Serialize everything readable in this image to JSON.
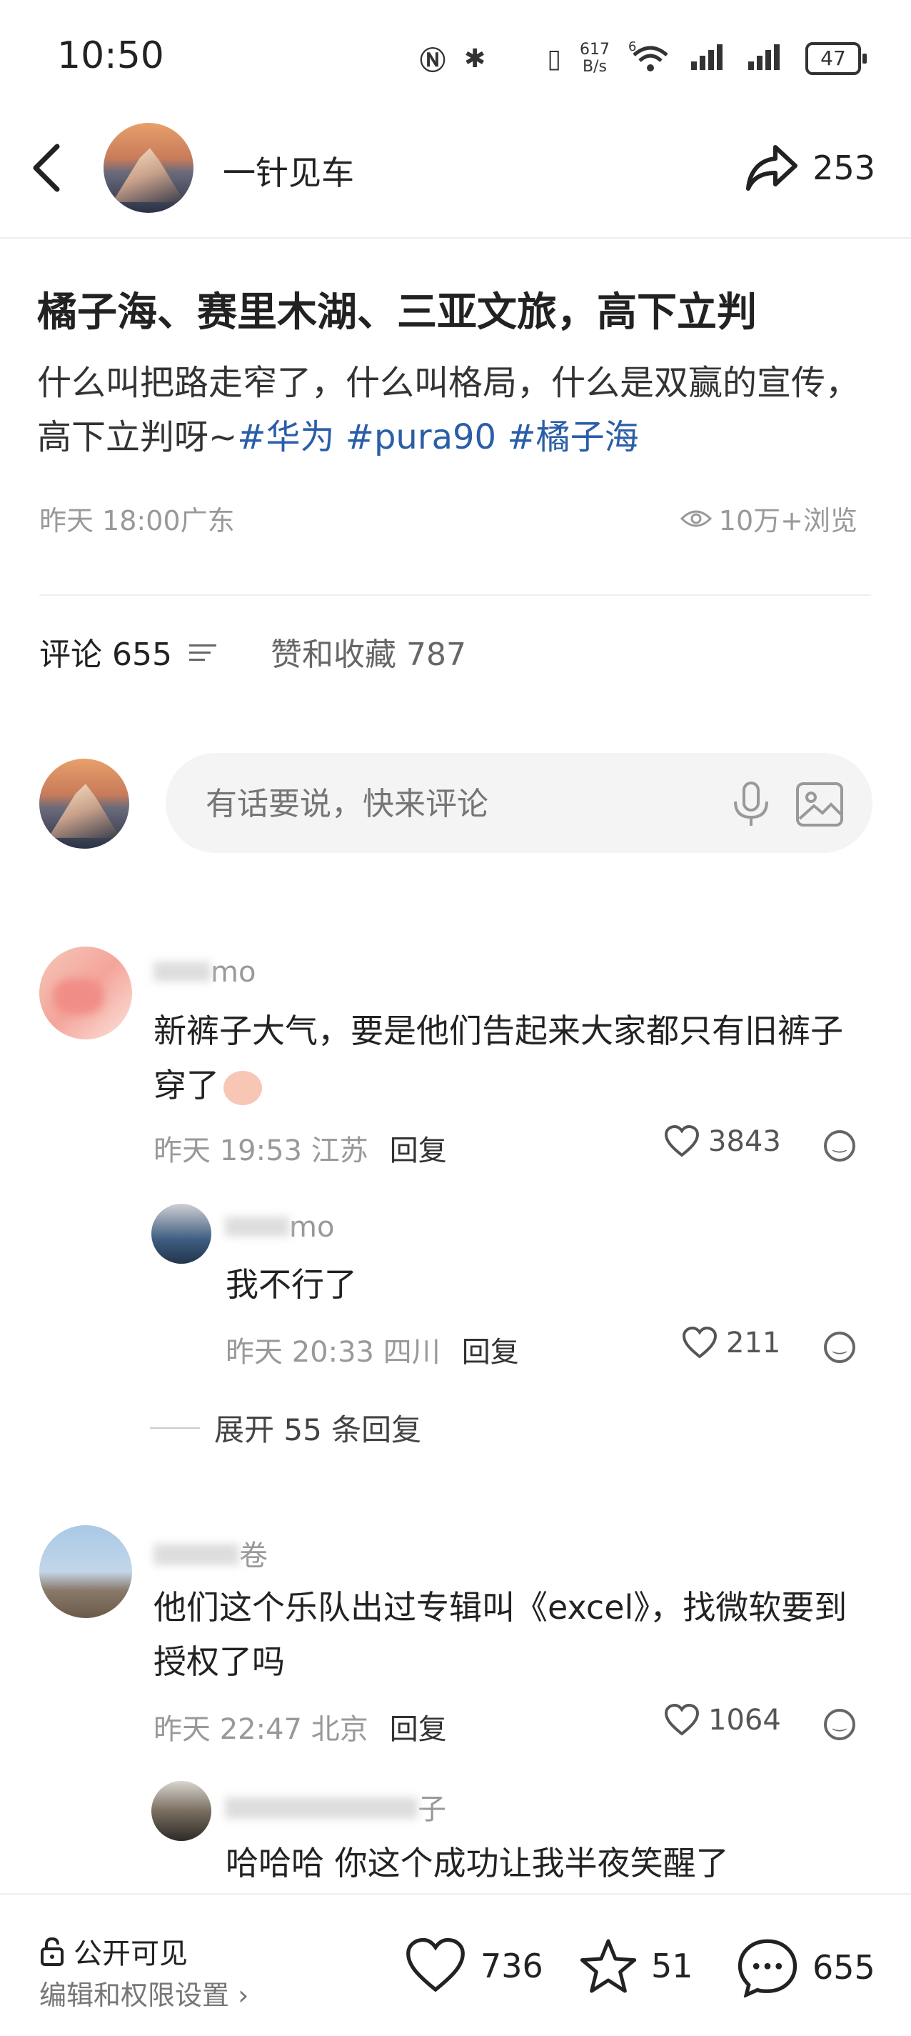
{
  "status": {
    "time": "10:50",
    "net_speed_top": "617",
    "net_speed_bottom": "B/s",
    "battery": "47",
    "signal_label": "6"
  },
  "header": {
    "author": "一针见车",
    "share_count": "253"
  },
  "post": {
    "title": "橘子海、赛里木湖、三亚文旅，高下立判",
    "body_text": "什么叫把路走窄了，什么叫格局，什么是双赢的宣传，高下立判呀~",
    "tags": [
      "#华为",
      "#pura90",
      "#橘子海"
    ],
    "date": "昨天 18:00",
    "location": "广东",
    "views": "10万+浏览"
  },
  "tabs": {
    "comments_label": "评论 655",
    "likes_label": "赞和收藏 787"
  },
  "comment_input": {
    "placeholder": "有话要说，快来评论"
  },
  "comments": [
    {
      "name": "mo",
      "text": "新裤子大气，要是他们告起来大家都只有旧裤子穿了",
      "time": "昨天 19:53 江苏",
      "reply": "回复",
      "likes": "3843"
    },
    {
      "name": "mo",
      "text": "我不行了",
      "time": "昨天 20:33 四川",
      "reply": "回复",
      "likes": "211"
    },
    {
      "name": "卷",
      "text": "他们这个乐队出过专辑叫《excel》，找微软要到授权了吗",
      "time": "昨天 22:47 北京",
      "reply": "回复",
      "likes": "1064"
    },
    {
      "name": "子",
      "text": "哈哈哈 你这个成功让我半夜笑醒了"
    }
  ],
  "expand_replies": "展开 55 条回复",
  "bottom_bar": {
    "visibility": "公开可见",
    "edit": "编辑和权限设置",
    "likes": "736",
    "stars": "51",
    "comments": "655"
  }
}
